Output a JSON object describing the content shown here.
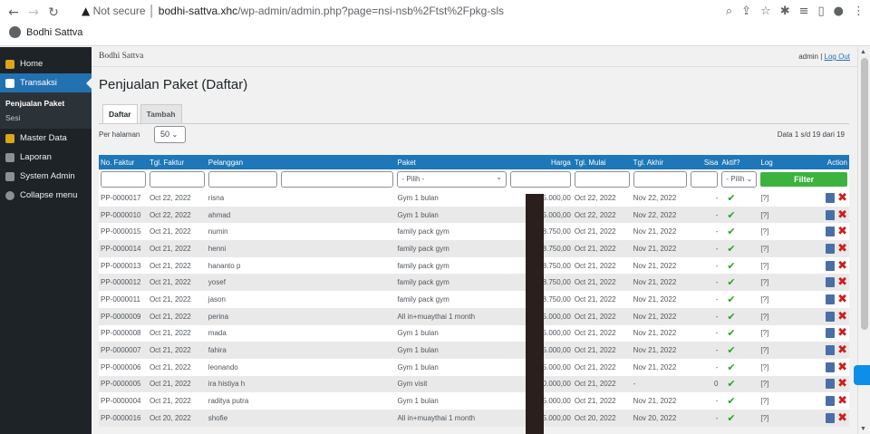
{
  "browser": {
    "not_secure": "Not secure",
    "host": "bodhi-sattva.xhc",
    "path": "/wp-admin/admin.php?page=nsi-nsb%2Ftst%2Fpkg-sls",
    "bookmark": "Bodhi Sattva"
  },
  "sidebar": {
    "items": [
      {
        "label": "Home",
        "color": "#dba617"
      },
      {
        "label": "Transaksi",
        "color": "#ffffff"
      },
      {
        "label": "Master Data",
        "color": "#dba617"
      },
      {
        "label": "Laporan",
        "color": "#c3c4c7"
      },
      {
        "label": "System Admin",
        "color": "#c3c4c7"
      },
      {
        "label": "Collapse menu",
        "color": "#c3c4c7"
      }
    ],
    "sub": [
      "Penjualan Paket",
      "Sesi"
    ]
  },
  "topbar": {
    "site": "Bodhi Sattva",
    "user": "admin",
    "sep": "|",
    "logout": "Log Out"
  },
  "page": {
    "title": "Penjualan Paket (Daftar)",
    "tabs": [
      "Daftar",
      "Tambah"
    ],
    "per_page_label": "Per halaman",
    "per_page_value": "50",
    "info": "Data 1 s/d 19 dari 19"
  },
  "table": {
    "headers": [
      "No. Faktur",
      "Tgl. Faktur",
      "Pelanggan",
      "",
      "Paket",
      "Harga",
      "Tgl. Mulai",
      "Tgl. Akhir",
      "Sisa",
      "Aktif?",
      "Log",
      "Action"
    ],
    "paket_select": "- Pilih -",
    "aktif_select": "- Pilih",
    "filter_btn": "Filter",
    "rows": [
      [
        "PP-0000017",
        "Oct 22, 2022",
        "risna",
        "Gym 1 bulan",
        "5.000,00",
        "Oct 22, 2022",
        "Nov 22, 2022",
        "-",
        "[?]"
      ],
      [
        "PP-0000010",
        "Oct 22, 2022",
        "ahmad",
        "Gym 1 bulan",
        "5.000,00",
        "Oct 22, 2022",
        "Nov 22, 2022",
        "-",
        "[?]"
      ],
      [
        "PP-0000015",
        "Oct 21, 2022",
        "numin",
        "family pack gym",
        "8.750,00",
        "Oct 21, 2022",
        "Nov 21, 2022",
        "-",
        "[?]"
      ],
      [
        "PP-0000014",
        "Oct 21, 2022",
        "henni",
        "family pack gym",
        "8.750,00",
        "Oct 21, 2022",
        "Nov 21, 2022",
        "-",
        "[?]"
      ],
      [
        "PP-0000013",
        "Oct 21, 2022",
        "hananto p",
        "family pack gym",
        "8.750,00",
        "Oct 21, 2022",
        "Nov 21, 2022",
        "-",
        "[?]"
      ],
      [
        "PP-0000012",
        "Oct 21, 2022",
        "yosef",
        "family pack gym",
        "8.750,00",
        "Oct 21, 2022",
        "Nov 21, 2022",
        "-",
        "[?]"
      ],
      [
        "PP-0000011",
        "Oct 21, 2022",
        "jason",
        "family pack gym",
        "8.750,00",
        "Oct 21, 2022",
        "Nov 21, 2022",
        "-",
        "[?]"
      ],
      [
        "PP-0000009",
        "Oct 21, 2022",
        "perina",
        "All in+muaythai 1 month",
        "5.000,00",
        "Oct 21, 2022",
        "Nov 21, 2022",
        "-",
        "[?]"
      ],
      [
        "PP-0000008",
        "Oct 21, 2022",
        "mada",
        "Gym 1 bulan",
        "5.000,00",
        "Oct 21, 2022",
        "Nov 21, 2022",
        "-",
        "[?]"
      ],
      [
        "PP-0000007",
        "Oct 21, 2022",
        "fahira",
        "Gym 1 bulan",
        "5.000,00",
        "Oct 21, 2022",
        "Nov 21, 2022",
        "-",
        "[?]"
      ],
      [
        "PP-0000006",
        "Oct 21, 2022",
        "leonando",
        "Gym 1 bulan",
        "5.000,00",
        "Oct 21, 2022",
        "Nov 21, 2022",
        "-",
        "[?]"
      ],
      [
        "PP-0000005",
        "Oct 21, 2022",
        "ira histiya h",
        "Gym visit",
        "0.000,00",
        "Oct 21, 2022",
        "-",
        "0",
        "[?]"
      ],
      [
        "PP-0000004",
        "Oct 21, 2022",
        "raditya putra",
        "Gym 1 bulan",
        "5.000,00",
        "Oct 21, 2022",
        "Nov 21, 2022",
        "-",
        "[?]"
      ],
      [
        "PP-0000016",
        "Oct 20, 2022",
        "shofie",
        "All in+muaythai 1 month",
        "5.000,00",
        "Oct 20, 2022",
        "Nov 20, 2022",
        "-",
        "[?]"
      ]
    ]
  }
}
